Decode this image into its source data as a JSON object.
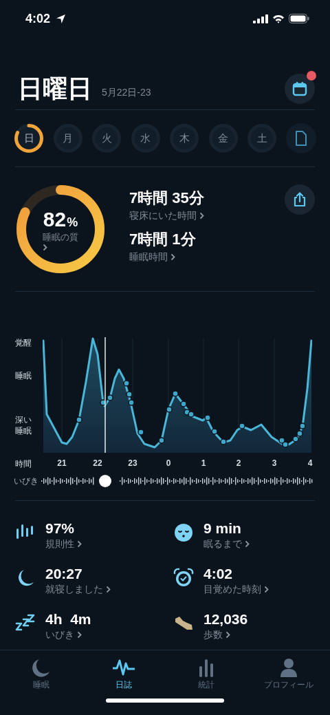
{
  "status_bar": {
    "time": "4:02"
  },
  "header": {
    "title": "日曜日",
    "date_range": "5月22日-23",
    "calendar_has_notification": true
  },
  "days": [
    {
      "label": "日",
      "selected": true
    },
    {
      "label": "月",
      "selected": false
    },
    {
      "label": "火",
      "selected": false
    },
    {
      "label": "水",
      "selected": false
    },
    {
      "label": "木",
      "selected": false
    },
    {
      "label": "金",
      "selected": false
    },
    {
      "label": "土",
      "selected": false
    }
  ],
  "quality": {
    "score": "82",
    "unit": "%",
    "label": "睡眠の質",
    "level": 0.82
  },
  "durations": [
    {
      "value": "7時間 35分",
      "label": "寝床にいた時間"
    },
    {
      "value": "7時間 1分",
      "label": "睡眠時間"
    }
  ],
  "chart": {
    "y_labels": [
      "覚醒",
      "睡眠",
      "深い睡眠"
    ],
    "x_label": "時間",
    "x_ticks": [
      "21",
      "22",
      "23",
      "0",
      "1",
      "2",
      "3",
      "4"
    ],
    "snore_label": "いびき"
  },
  "stats": [
    {
      "kind": "regularity",
      "value": "97%",
      "label": "規則性"
    },
    {
      "kind": "latency",
      "value": "9 min",
      "label": "眠るまで"
    },
    {
      "kind": "bedtime",
      "value": "20:27",
      "label": "就寝しました"
    },
    {
      "kind": "wakeup",
      "value": "4:02",
      "label": "目覚めた時刻"
    },
    {
      "kind": "snoring",
      "value": "4h  4m",
      "label": "いびき"
    },
    {
      "kind": "steps",
      "value": "12,036",
      "label": "歩数"
    }
  ],
  "tabs": [
    {
      "kind": "sleep",
      "label": "睡眠",
      "selected": false
    },
    {
      "kind": "journal",
      "label": "日誌",
      "selected": true
    },
    {
      "kind": "stats",
      "label": "統計",
      "selected": false
    },
    {
      "kind": "profile",
      "label": "プロフィール",
      "selected": false
    }
  ]
}
